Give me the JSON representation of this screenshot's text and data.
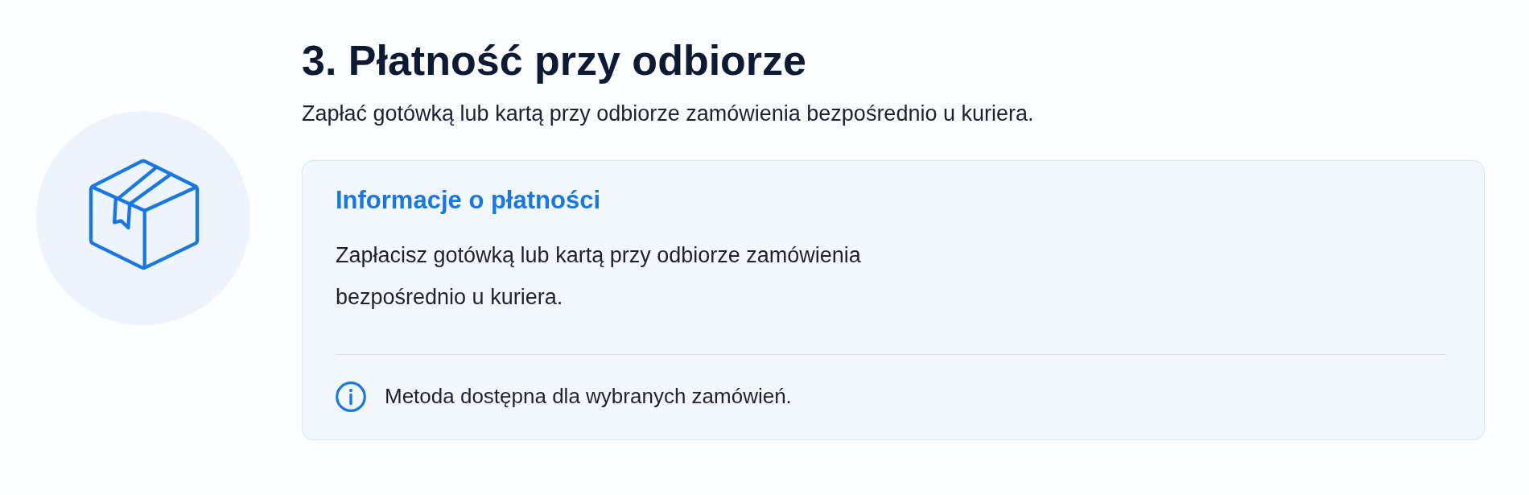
{
  "section": {
    "title": "3. Płatność przy odbiorze",
    "description": "Zapłać gotówką lub kartą przy odbiorze zamówienia bezpośrednio u kuriera."
  },
  "card": {
    "title": "Informacje o płatności",
    "text": "Zapłacisz gotówką lub kartą przy odbiorze zamówienia bezpośrednio u kuriera.",
    "note": "Metoda dostępna dla wybranych zamówień."
  }
}
